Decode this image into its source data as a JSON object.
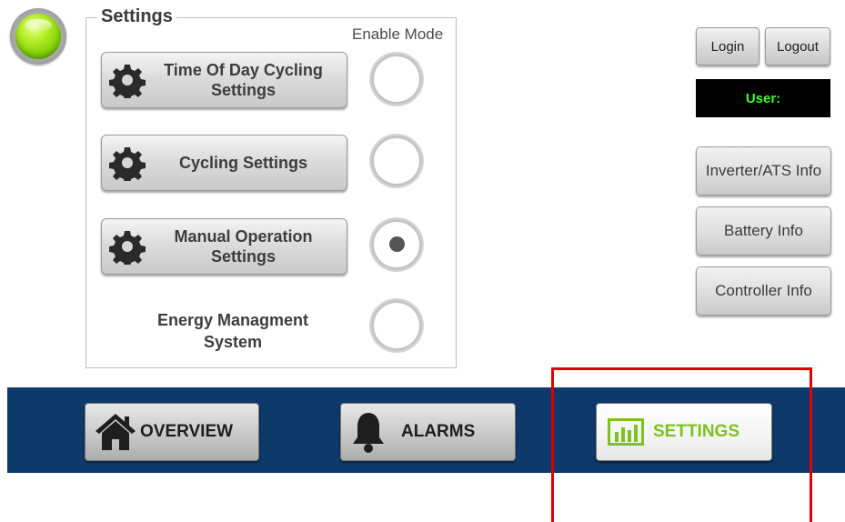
{
  "status_indicator": {
    "color": "#78c800"
  },
  "settings_panel": {
    "title": "Settings",
    "enable_mode_header": "Enable Mode",
    "items": [
      {
        "label_line1": "Time Of Day Cycling",
        "label_line2": "Settings",
        "icon": "gear-icon",
        "enabled": false
      },
      {
        "label_line1": "Cycling Settings",
        "label_line2": "",
        "icon": "gear-icon",
        "enabled": false
      },
      {
        "label_line1": "Manual Operation",
        "label_line2": "Settings",
        "icon": "gear-icon",
        "enabled": true
      },
      {
        "label_line1": "Energy Managment",
        "label_line2": "System",
        "icon": "",
        "enabled": false
      }
    ]
  },
  "account": {
    "login_label": "Login",
    "logout_label": "Logout",
    "user_label": "User:",
    "user_text_color": "#3cff2a"
  },
  "info_buttons": {
    "inverter_label": "Inverter/ATS Info",
    "battery_label": "Battery Info",
    "controller_label": "Controller Info"
  },
  "nav": {
    "bar_color": "#0e3a6b",
    "overview_label": "OVERVIEW",
    "alarms_label": "ALARMS",
    "settings_label": "SETTINGS",
    "active_tab": "SETTINGS",
    "active_color": "#7ec21d",
    "highlight_color": "#e00000"
  }
}
